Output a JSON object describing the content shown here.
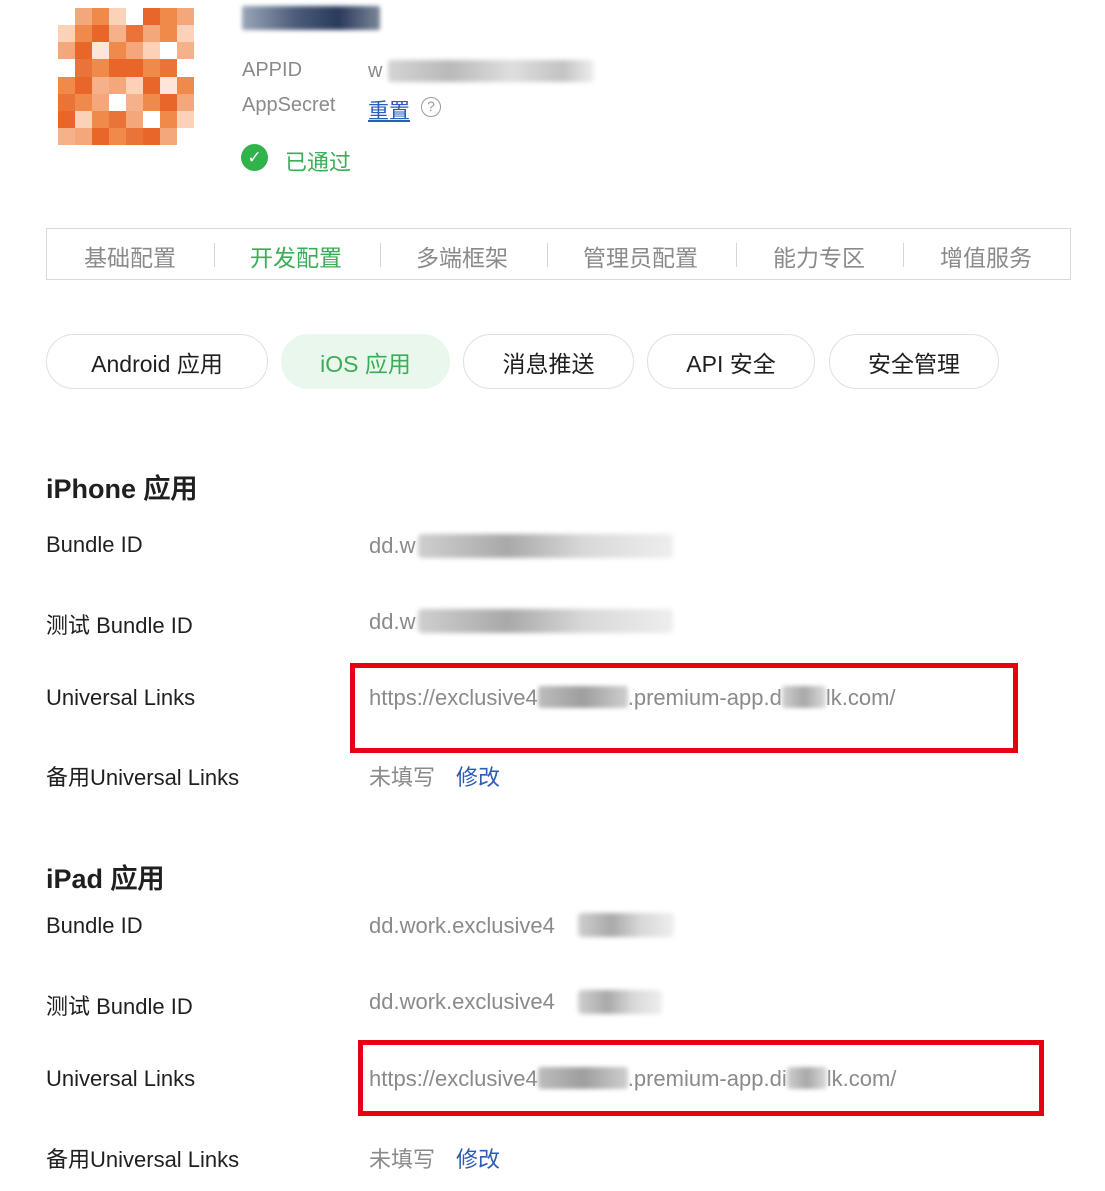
{
  "header": {
    "appid_label": "APPID",
    "appid_value_visible": "w",
    "appsecret_label": "AppSecret",
    "reset_label": "重置",
    "help_glyph": "?",
    "status_text": "已通过",
    "status_color": "#2fb34a"
  },
  "top_tabs": [
    {
      "label": "基础配置"
    },
    {
      "label": "开发配置"
    },
    {
      "label": "多端框架"
    },
    {
      "label": "管理员配置"
    },
    {
      "label": "能力专区"
    },
    {
      "label": "增值服务"
    }
  ],
  "top_tabs_active": "开发配置",
  "sub_tabs": [
    {
      "label": "Android 应用"
    },
    {
      "label": "iOS 应用"
    },
    {
      "label": "消息推送"
    },
    {
      "label": "API 安全"
    },
    {
      "label": "安全管理"
    }
  ],
  "sub_tabs_active": "iOS 应用",
  "accent_color": "#3aad56",
  "link_color": "#2a5cb8",
  "highlight_color": "#e60012",
  "iphone": {
    "title": "iPhone 应用",
    "bundle_id_label": "Bundle ID",
    "bundle_id_value": "dd.w",
    "test_bundle_id_label": "测试 Bundle ID",
    "test_bundle_id_value": "dd.w",
    "universal_links_label": "Universal Links",
    "universal_links_part1": "https://exclusive4",
    "universal_links_part2": ".premium-app.d",
    "universal_links_part3": "lk.com/",
    "backup_links_label": "备用Universal Links",
    "backup_links_value": "未填写",
    "backup_links_edit": "修改"
  },
  "ipad": {
    "title": "iPad 应用",
    "bundle_id_label": "Bundle ID",
    "bundle_id_value": "dd.work.exclusive4",
    "test_bundle_id_label": "测试 Bundle ID",
    "test_bundle_id_value": "dd.work.exclusive4",
    "universal_links_label": "Universal Links",
    "universal_links_part1": "https://exclusive4",
    "universal_links_part2": ".premium-app.di",
    "universal_links_part3": "lk.com/",
    "backup_links_label": "备用Universal Links",
    "backup_links_value": "未填写",
    "backup_links_edit": "修改"
  }
}
